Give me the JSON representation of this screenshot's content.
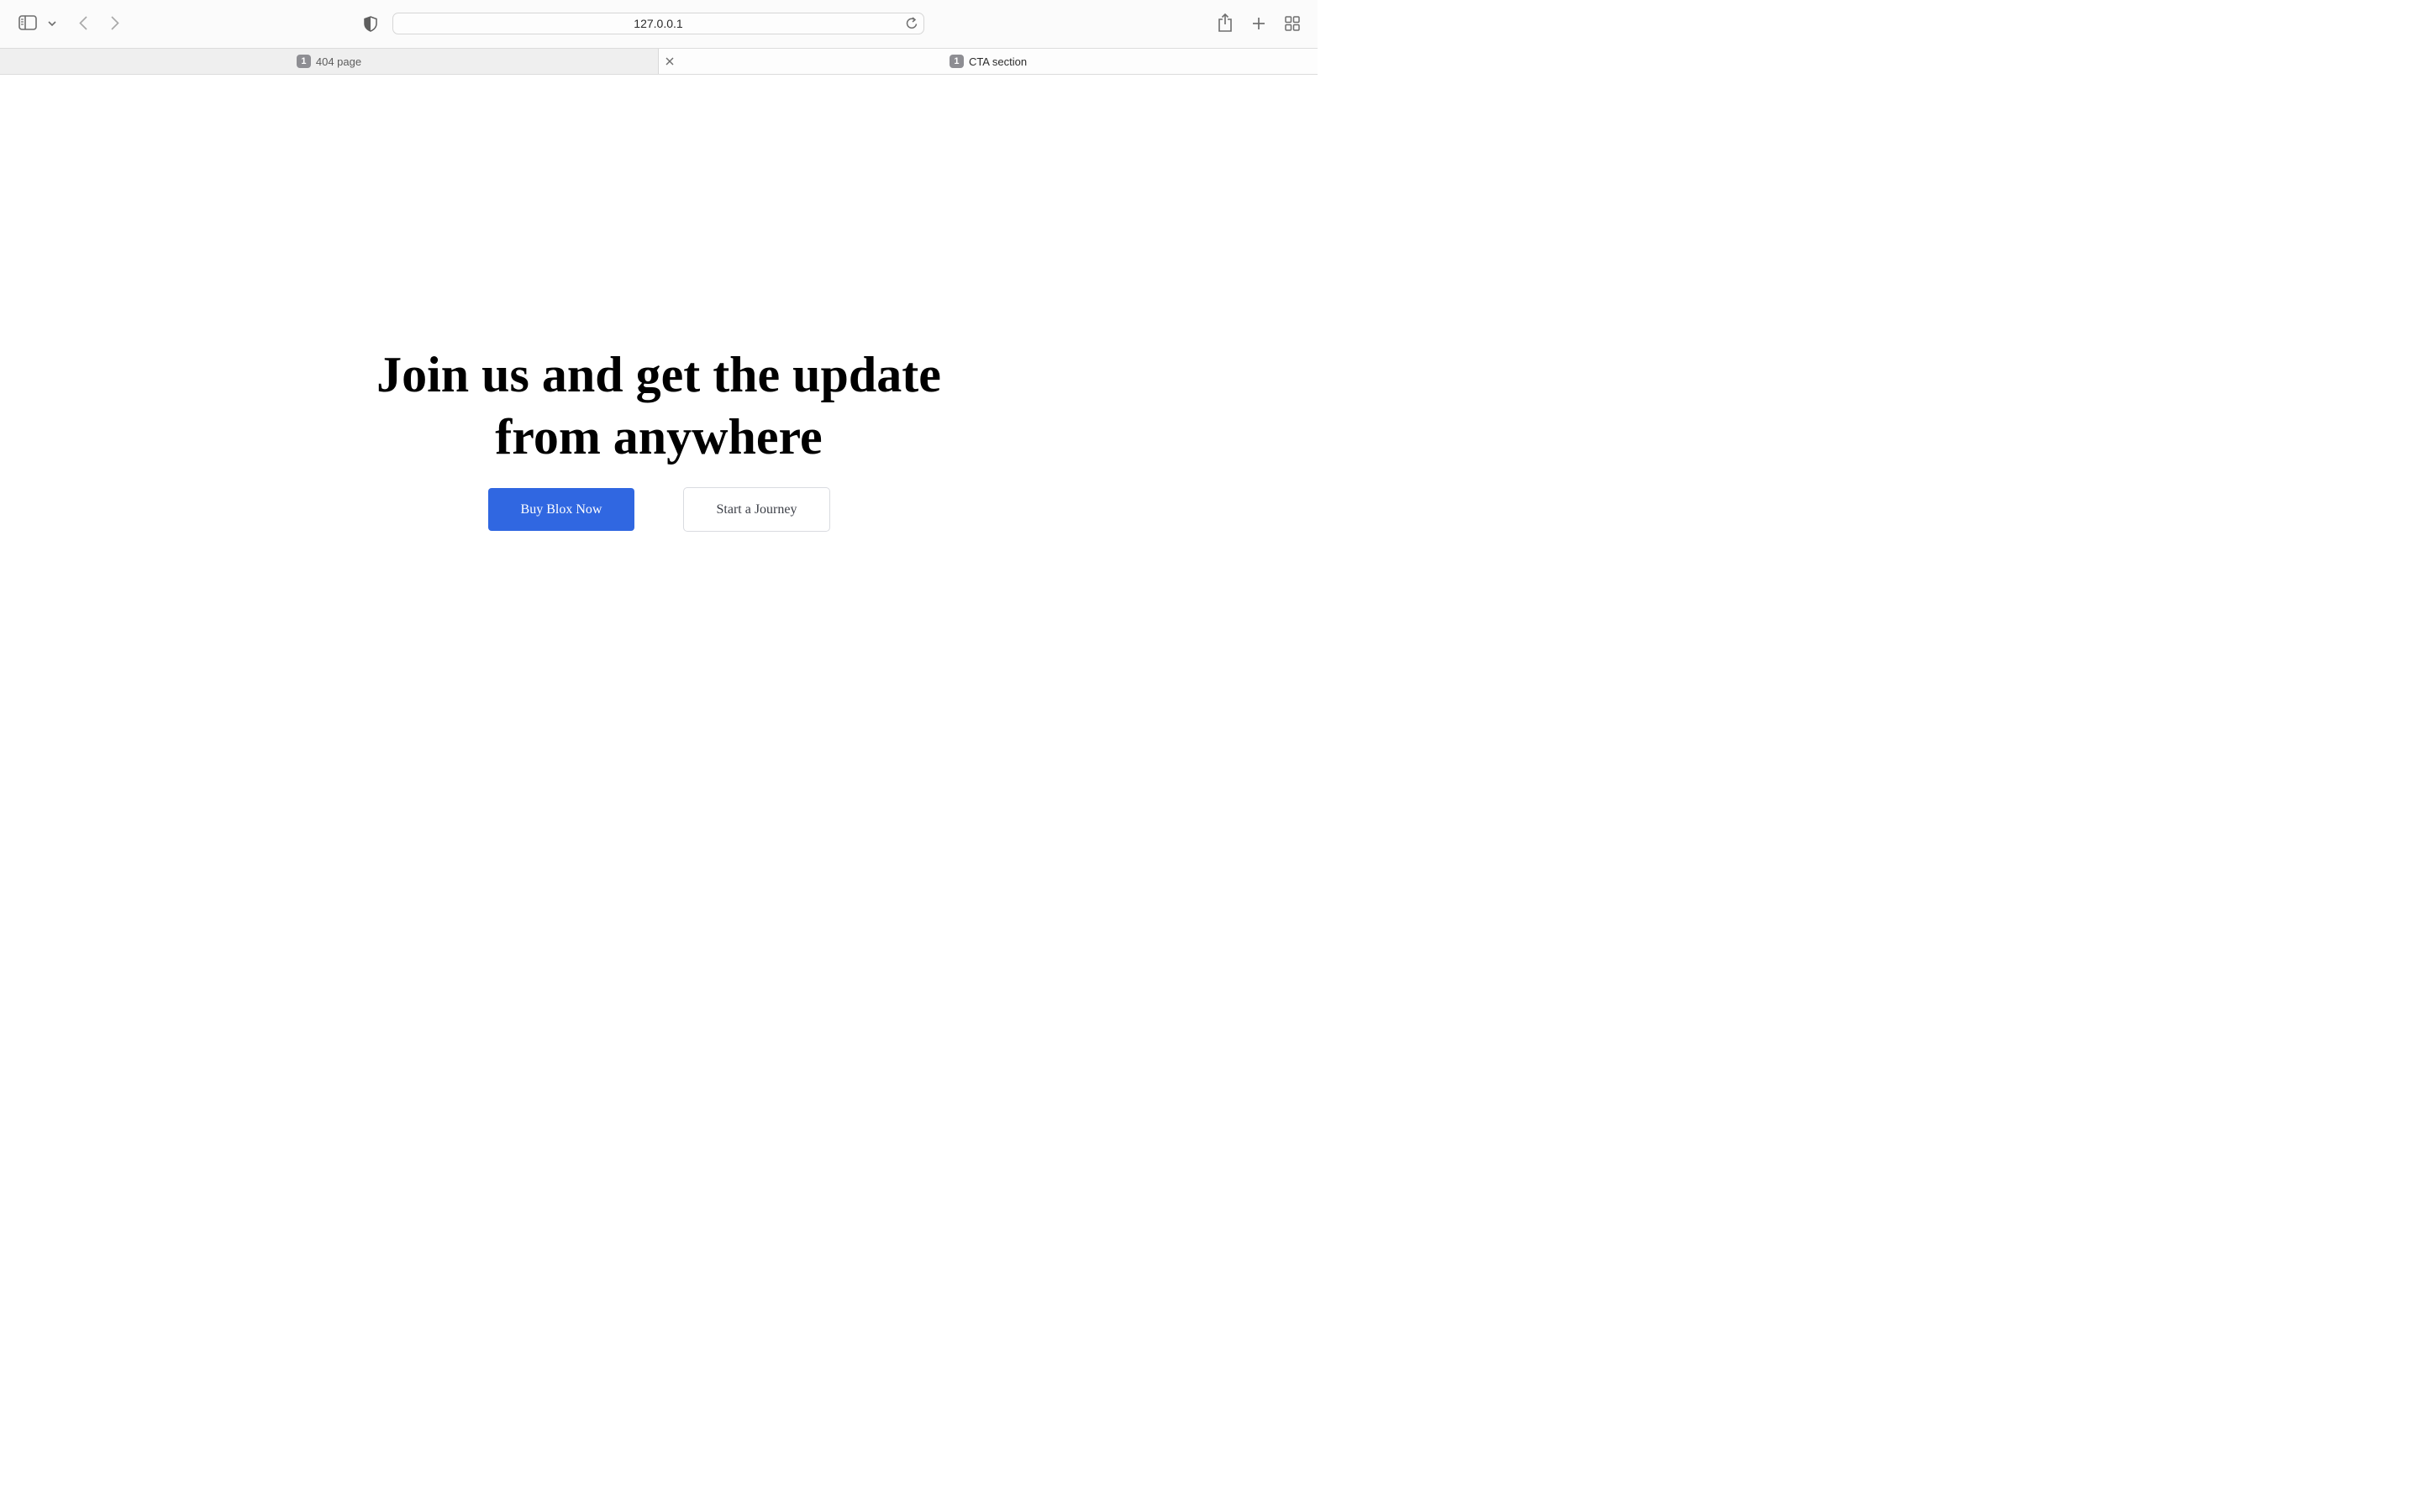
{
  "browser": {
    "url": "127.0.0.1",
    "icons": {
      "sidebar": "sidebar-icon",
      "sidebar_menu": "chevron-down-icon",
      "back": "chevron-left-icon",
      "forward": "chevron-right-icon",
      "privacy": "shield-icon",
      "reload": "reload-icon",
      "share": "share-icon",
      "new_tab": "plus-icon",
      "tab_overview": "grid-icon",
      "close_tab": "close-icon"
    }
  },
  "tabs": [
    {
      "badge": "1",
      "label": "404 page",
      "active": false
    },
    {
      "badge": "1",
      "label": "CTA section",
      "active": true
    }
  ],
  "cta": {
    "headline": "Join us and get the update from anywhere",
    "primary_button": "Buy Blox Now",
    "secondary_button": "Start a Journey"
  },
  "colors": {
    "primary_button_bg": "#3067e1",
    "headline": "#000000",
    "secondary_border": "#d9dbe0"
  }
}
